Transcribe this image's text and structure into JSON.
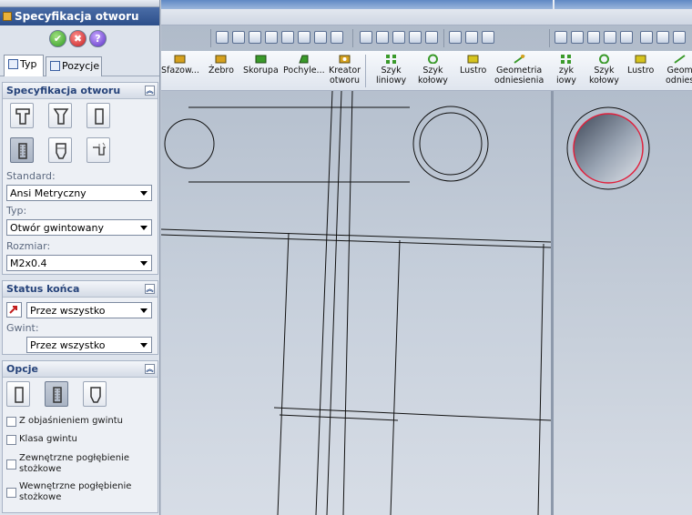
{
  "property_manager": {
    "title": "Specyfikacja otworu",
    "tabs": [
      {
        "label": "Typ"
      },
      {
        "label": "Pozycje"
      }
    ],
    "spec_group": {
      "title": "Specyfikacja otworu",
      "standard_label": "Standard:",
      "standard_value": "Ansi Metryczny",
      "type_label": "Typ:",
      "type_value": "Otwór gwintowany",
      "size_label": "Rozmiar:",
      "size_value": "M2x0.4"
    },
    "end_group": {
      "title": "Status końca",
      "end_value": "Przez wszystko",
      "thread_label": "Gwint:",
      "thread_value": "Przez wszystko"
    },
    "options_group": {
      "title": "Opcje",
      "checkboxes": [
        {
          "label": "Z objaśnieniem gwintu"
        },
        {
          "label": "Klasa gwintu"
        },
        {
          "label": "Zewnętrzne pogłębienie stożkowe"
        },
        {
          "label": "Wewnętrzne pogłębienie stożkowe"
        }
      ]
    }
  },
  "command_bar": {
    "items": [
      {
        "label": "Sfazow...",
        "color": "#3a9a2a"
      },
      {
        "label": "Żebro",
        "color": "#3a9a2a"
      },
      {
        "label": "Skorupa",
        "color": "#3a9a2a"
      },
      {
        "label": "Pochyle...",
        "color": "#3a9a2a"
      },
      {
        "label": "Kreator\notworu",
        "color": "#d6a11e"
      },
      {
        "label": "Szyk\nliniowy",
        "color": "#3a9a2a"
      },
      {
        "label": "Szyk\nkołowy",
        "color": "#3a9a2a"
      },
      {
        "label": "Lustro",
        "color": "#d6c41e"
      },
      {
        "label": "Geometria\nodniesienia",
        "color": "#3a9a2a"
      }
    ],
    "right_items": [
      {
        "label": "zyk\niowy"
      },
      {
        "label": "Szyk\nkołowy"
      },
      {
        "label": "Lustro"
      },
      {
        "label": "Geom\nodnies"
      }
    ]
  },
  "colors": {
    "accent": "#2d4f8a",
    "hole_edge": "#e0203c"
  }
}
